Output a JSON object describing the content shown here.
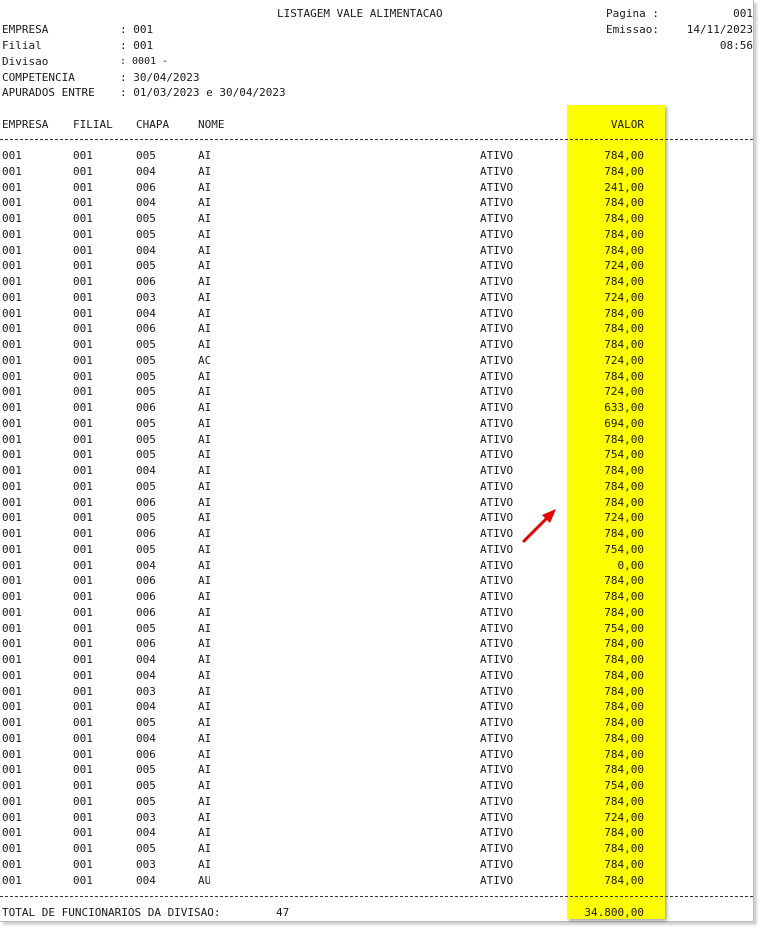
{
  "header": {
    "title": "LISTAGEM VALE ALIMENTACAO",
    "pagina_label": "Pagina :",
    "pagina_value": "001",
    "emissao_label": "Emissao:",
    "emissao_value": "14/11/2023",
    "hora": "08:56",
    "fields": [
      {
        "label": "EMPRESA",
        "value": ": 001"
      },
      {
        "label": "Filial",
        "value": ": 001"
      },
      {
        "label": "Divisao",
        "value": ": 0001 -"
      },
      {
        "label": "COMPETENCIA",
        "value": ": 30/04/2023"
      },
      {
        "label": "APURADOS ENTRE",
        "value": ": 01/03/2023 e 30/04/2023"
      }
    ]
  },
  "columns": {
    "empresa": "EMPRESA",
    "filial": "FILIAL",
    "chapa": "CHAPA",
    "nome": "NOME",
    "valor": "VALOR"
  },
  "rows": [
    {
      "e": "001",
      "f": "001",
      "c": "005",
      "n": "AI",
      "s": "ATIVO",
      "v": "784,00"
    },
    {
      "e": "001",
      "f": "001",
      "c": "004",
      "n": "AI",
      "s": "ATIVO",
      "v": "784,00"
    },
    {
      "e": "001",
      "f": "001",
      "c": "006",
      "n": "AI",
      "s": "ATIVO",
      "v": "241,00"
    },
    {
      "e": "001",
      "f": "001",
      "c": "004",
      "n": "AI",
      "s": "ATIVO",
      "v": "784,00"
    },
    {
      "e": "001",
      "f": "001",
      "c": "005",
      "n": "AI",
      "s": "ATIVO",
      "v": "784,00"
    },
    {
      "e": "001",
      "f": "001",
      "c": "005",
      "n": "AI",
      "s": "ATIVO",
      "v": "784,00"
    },
    {
      "e": "001",
      "f": "001",
      "c": "004",
      "n": "AI",
      "s": "ATIVO",
      "v": "784,00"
    },
    {
      "e": "001",
      "f": "001",
      "c": "005",
      "n": "AI",
      "s": "ATIVO",
      "v": "724,00"
    },
    {
      "e": "001",
      "f": "001",
      "c": "006",
      "n": "AI",
      "s": "ATIVO",
      "v": "784,00"
    },
    {
      "e": "001",
      "f": "001",
      "c": "003",
      "n": "AI",
      "s": "ATIVO",
      "v": "724,00"
    },
    {
      "e": "001",
      "f": "001",
      "c": "004",
      "n": "AI",
      "s": "ATIVO",
      "v": "784,00"
    },
    {
      "e": "001",
      "f": "001",
      "c": "006",
      "n": "AI",
      "s": "ATIVO",
      "v": "784,00"
    },
    {
      "e": "001",
      "f": "001",
      "c": "005",
      "n": "AI",
      "s": "ATIVO",
      "v": "784,00"
    },
    {
      "e": "001",
      "f": "001",
      "c": "005",
      "n": "AC",
      "s": "ATIVO",
      "v": "724,00"
    },
    {
      "e": "001",
      "f": "001",
      "c": "005",
      "n": "AI",
      "s": "ATIVO",
      "v": "784,00"
    },
    {
      "e": "001",
      "f": "001",
      "c": "005",
      "n": "AI",
      "s": "ATIVO",
      "v": "724,00"
    },
    {
      "e": "001",
      "f": "001",
      "c": "006",
      "n": "AI",
      "s": "ATIVO",
      "v": "633,00"
    },
    {
      "e": "001",
      "f": "001",
      "c": "005",
      "n": "AI",
      "s": "ATIVO",
      "v": "694,00"
    },
    {
      "e": "001",
      "f": "001",
      "c": "005",
      "n": "AI",
      "s": "ATIVO",
      "v": "784,00"
    },
    {
      "e": "001",
      "f": "001",
      "c": "005",
      "n": "AI",
      "s": "ATIVO",
      "v": "754,00"
    },
    {
      "e": "001",
      "f": "001",
      "c": "004",
      "n": "AI",
      "s": "ATIVO",
      "v": "784,00"
    },
    {
      "e": "001",
      "f": "001",
      "c": "005",
      "n": "AI",
      "s": "ATIVO",
      "v": "784,00"
    },
    {
      "e": "001",
      "f": "001",
      "c": "006",
      "n": "AI",
      "s": "ATIVO",
      "v": "784,00"
    },
    {
      "e": "001",
      "f": "001",
      "c": "005",
      "n": "AI",
      "s": "ATIVO",
      "v": "724,00"
    },
    {
      "e": "001",
      "f": "001",
      "c": "006",
      "n": "AI",
      "s": "ATIVO",
      "v": "784,00"
    },
    {
      "e": "001",
      "f": "001",
      "c": "005",
      "n": "AI",
      "s": "ATIVO",
      "v": "754,00"
    },
    {
      "e": "001",
      "f": "001",
      "c": "004",
      "n": "AI",
      "s": "ATIVO",
      "v": "0,00"
    },
    {
      "e": "001",
      "f": "001",
      "c": "006",
      "n": "AI",
      "s": "ATIVO",
      "v": "784,00"
    },
    {
      "e": "001",
      "f": "001",
      "c": "006",
      "n": "AI",
      "s": "ATIVO",
      "v": "784,00"
    },
    {
      "e": "001",
      "f": "001",
      "c": "006",
      "n": "AI",
      "s": "ATIVO",
      "v": "784,00"
    },
    {
      "e": "001",
      "f": "001",
      "c": "005",
      "n": "AI",
      "s": "ATIVO",
      "v": "754,00"
    },
    {
      "e": "001",
      "f": "001",
      "c": "006",
      "n": "AI",
      "s": "ATIVO",
      "v": "784,00"
    },
    {
      "e": "001",
      "f": "001",
      "c": "004",
      "n": "AI",
      "s": "ATIVO",
      "v": "784,00"
    },
    {
      "e": "001",
      "f": "001",
      "c": "004",
      "n": "AI",
      "s": "ATIVO",
      "v": "784,00"
    },
    {
      "e": "001",
      "f": "001",
      "c": "003",
      "n": "AI",
      "s": "ATIVO",
      "v": "784,00"
    },
    {
      "e": "001",
      "f": "001",
      "c": "004",
      "n": "AI",
      "s": "ATIVO",
      "v": "784,00"
    },
    {
      "e": "001",
      "f": "001",
      "c": "005",
      "n": "AI",
      "s": "ATIVO",
      "v": "784,00"
    },
    {
      "e": "001",
      "f": "001",
      "c": "004",
      "n": "AI",
      "s": "ATIVO",
      "v": "784,00"
    },
    {
      "e": "001",
      "f": "001",
      "c": "006",
      "n": "AI",
      "s": "ATIVO",
      "v": "784,00"
    },
    {
      "e": "001",
      "f": "001",
      "c": "005",
      "n": "AI",
      "s": "ATIVO",
      "v": "784,00"
    },
    {
      "e": "001",
      "f": "001",
      "c": "005",
      "n": "AI",
      "s": "ATIVO",
      "v": "754,00"
    },
    {
      "e": "001",
      "f": "001",
      "c": "005",
      "n": "AI",
      "s": "ATIVO",
      "v": "784,00"
    },
    {
      "e": "001",
      "f": "001",
      "c": "003",
      "n": "AI",
      "s": "ATIVO",
      "v": "724,00"
    },
    {
      "e": "001",
      "f": "001",
      "c": "004",
      "n": "AI",
      "s": "ATIVO",
      "v": "784,00"
    },
    {
      "e": "001",
      "f": "001",
      "c": "005",
      "n": "AI",
      "s": "ATIVO",
      "v": "784,00"
    },
    {
      "e": "001",
      "f": "001",
      "c": "003",
      "n": "AI",
      "s": "ATIVO",
      "v": "784,00"
    },
    {
      "e": "001",
      "f": "001",
      "c": "004",
      "n": "AU",
      "s": "ATIVO",
      "v": "784,00"
    }
  ],
  "footer": {
    "total_label": "TOTAL DE FUNCIONARIOS DA DIVISAO:",
    "total_count": "47",
    "total_value": "34.800,00"
  },
  "colors": {
    "highlight": "#ffff00",
    "arrow": "#e00000"
  },
  "icons": {
    "annotation": "red-arrow-icon"
  }
}
